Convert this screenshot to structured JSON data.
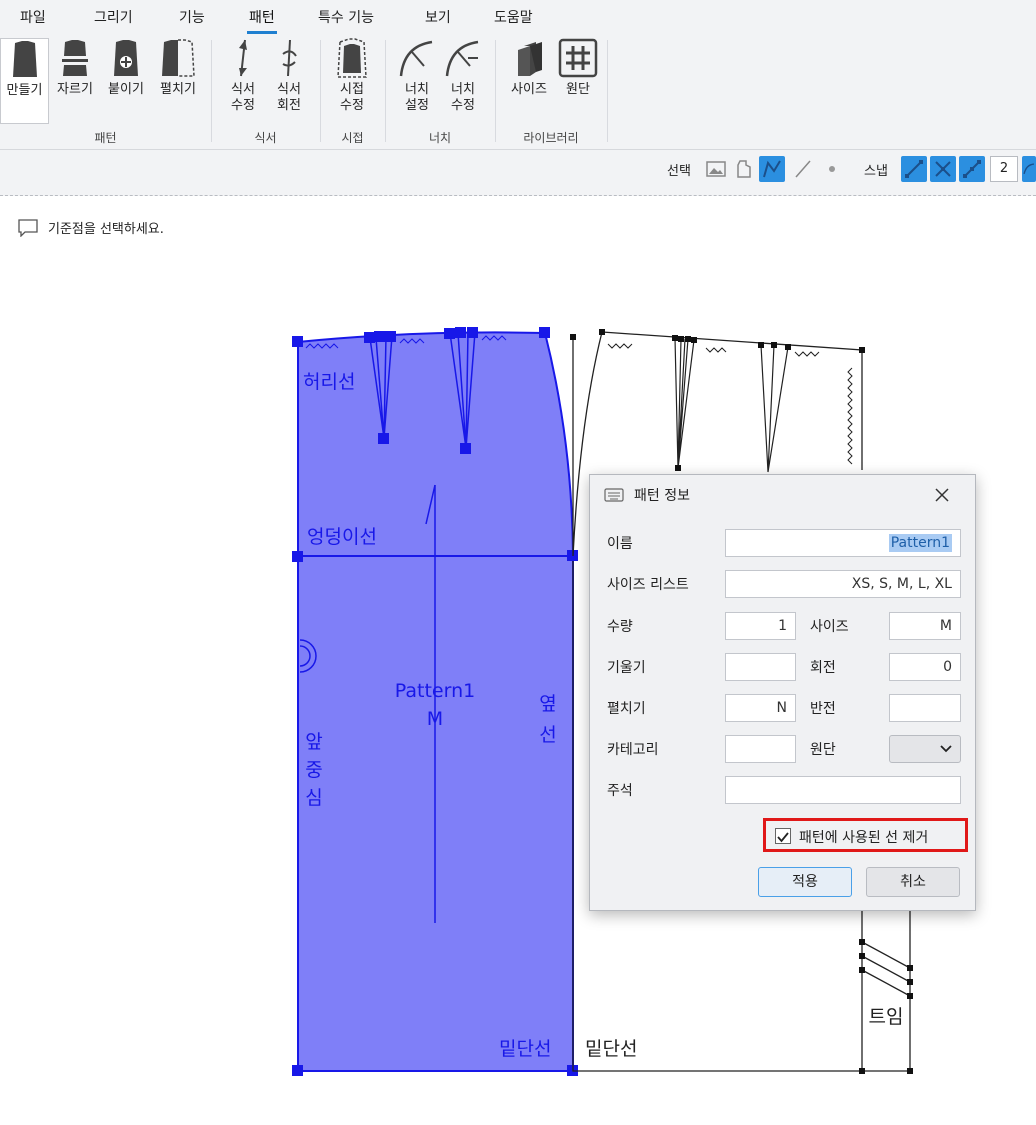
{
  "menu": [
    "파일",
    "그리기",
    "기능",
    "패턴",
    "특수 기능",
    "보기",
    "도움말"
  ],
  "ribbon": {
    "tools": [
      {
        "label": "만들기",
        "icon": "create-pattern-icon"
      },
      {
        "label": "자르기",
        "icon": "cut-pattern-icon"
      },
      {
        "label": "붙이기",
        "icon": "attach-pattern-icon"
      },
      {
        "label": "펼치기",
        "icon": "unfold-pattern-icon"
      },
      {
        "label": "식서 수정",
        "line1": "식서",
        "line2": "수정",
        "icon": "grainline-edit-icon"
      },
      {
        "label": "식서 회전",
        "line1": "식서",
        "line2": "회전",
        "icon": "grainline-rotate-icon"
      },
      {
        "label": "시접 수정",
        "line1": "시접",
        "line2": "수정",
        "icon": "seam-allowance-icon"
      },
      {
        "label": "너치 설정",
        "line1": "너치",
        "line2": "설정",
        "icon": "notch-set-icon"
      },
      {
        "label": "너치 수정",
        "line1": "너치",
        "line2": "수정",
        "icon": "notch-edit-icon"
      },
      {
        "label": "사이즈",
        "icon": "size-library-icon"
      },
      {
        "label": "원단",
        "icon": "fabric-library-icon"
      }
    ],
    "groups": [
      "패턴",
      "식서",
      "시접",
      "너치",
      "라이브러리"
    ]
  },
  "subbar": {
    "select_label": "선택",
    "snap_label": "스냅",
    "snap_value": "2"
  },
  "status": {
    "message": "기준점을 선택하세요."
  },
  "canvas": {
    "labels": {
      "waistline": "허리선",
      "hipline": "엉덩이선",
      "pattern_name": "Pattern1",
      "pattern_size": "M",
      "side_line_1": "옆",
      "side_line_2": "선",
      "center_front_1": "앞",
      "center_front_2": "중",
      "center_front_3": "심",
      "hem_selected": "밑단선",
      "hem_other": "밑단선",
      "slit": "트임"
    },
    "colors": {
      "selected_fill": "#7f7ff8",
      "selected_stroke": "#1818e8",
      "outline": "#222222"
    }
  },
  "dialog": {
    "title": "패턴 정보",
    "fields": {
      "name_label": "이름",
      "name_value": "Pattern1",
      "sizes_label": "사이즈 리스트",
      "sizes_value": "XS, S, M, L, XL",
      "qty_label": "수량",
      "qty_value": "1",
      "size_label": "사이즈",
      "size_value": "M",
      "slope_label": "기울기",
      "slope_value": "",
      "rotate_label": "회전",
      "rotate_value": "0",
      "unfold_label": "펼치기",
      "unfold_value": "N",
      "flip_label": "반전",
      "flip_value": "",
      "category_label": "카테고리",
      "category_value": "",
      "fabric_label": "원단",
      "fabric_value": "",
      "note_label": "주석",
      "note_value": ""
    },
    "remove_lines_label": "패턴에 사용된 선 제거",
    "remove_lines_checked": true,
    "apply_label": "적용",
    "cancel_label": "취소"
  }
}
